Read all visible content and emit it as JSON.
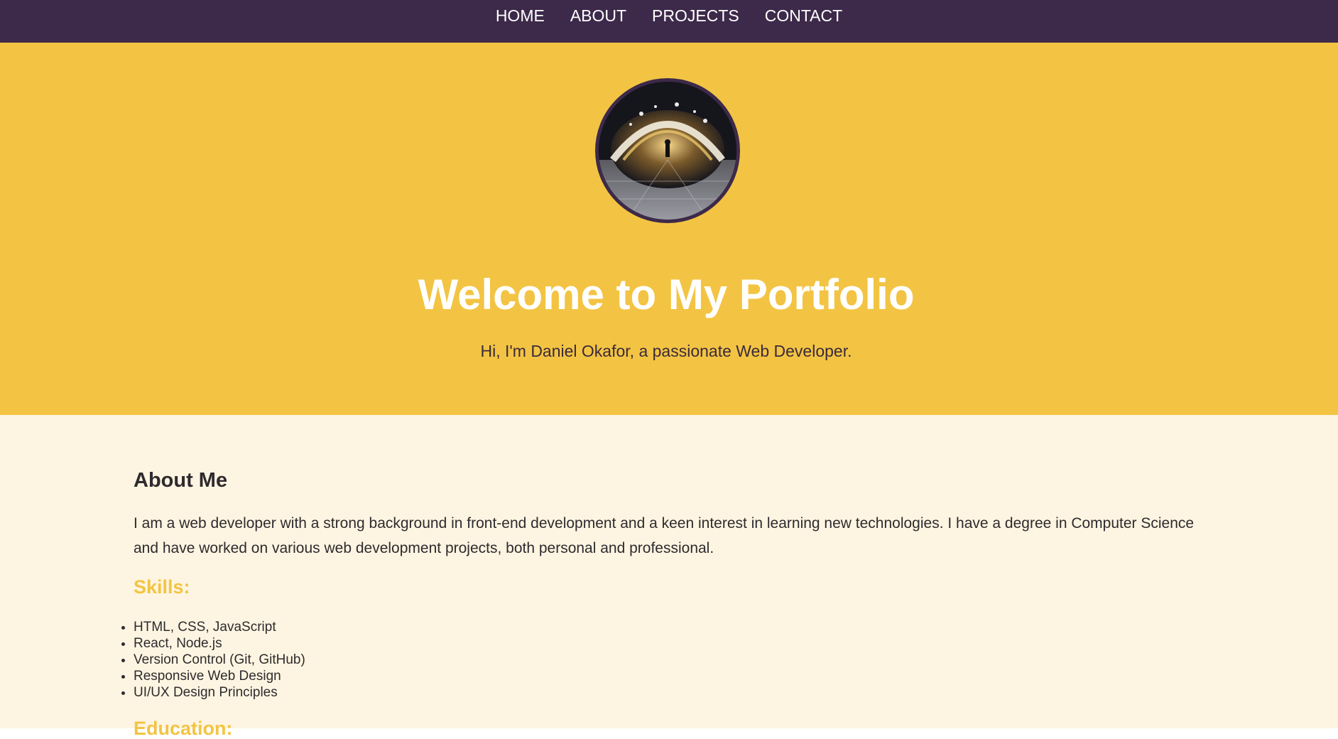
{
  "nav": {
    "items": [
      {
        "label": "HOME"
      },
      {
        "label": "ABOUT"
      },
      {
        "label": "PROJECTS"
      },
      {
        "label": "CONTACT"
      }
    ]
  },
  "hero": {
    "title": "Welcome to My Portfolio",
    "subtitle": "Hi, I'm Daniel Okafor, a passionate Web Developer."
  },
  "about": {
    "title": "About Me",
    "text": "I am a web developer with a strong background in front-end development and a keen interest in learning new technologies. I have a degree in Computer Science and have worked on various web development projects, both personal and professional.",
    "skills_title": "Skills:",
    "skills": [
      "HTML, CSS, JavaScript",
      "React, Node.js",
      "Version Control (Git, GitHub)",
      "Responsive Web Design",
      "UI/UX Design Principles"
    ],
    "education_title": "Education:"
  },
  "colors": {
    "nav_bg": "#3d2a4a",
    "hero_bg": "#f3c443",
    "main_bg": "#fdf5e1",
    "accent": "#f3c443"
  }
}
